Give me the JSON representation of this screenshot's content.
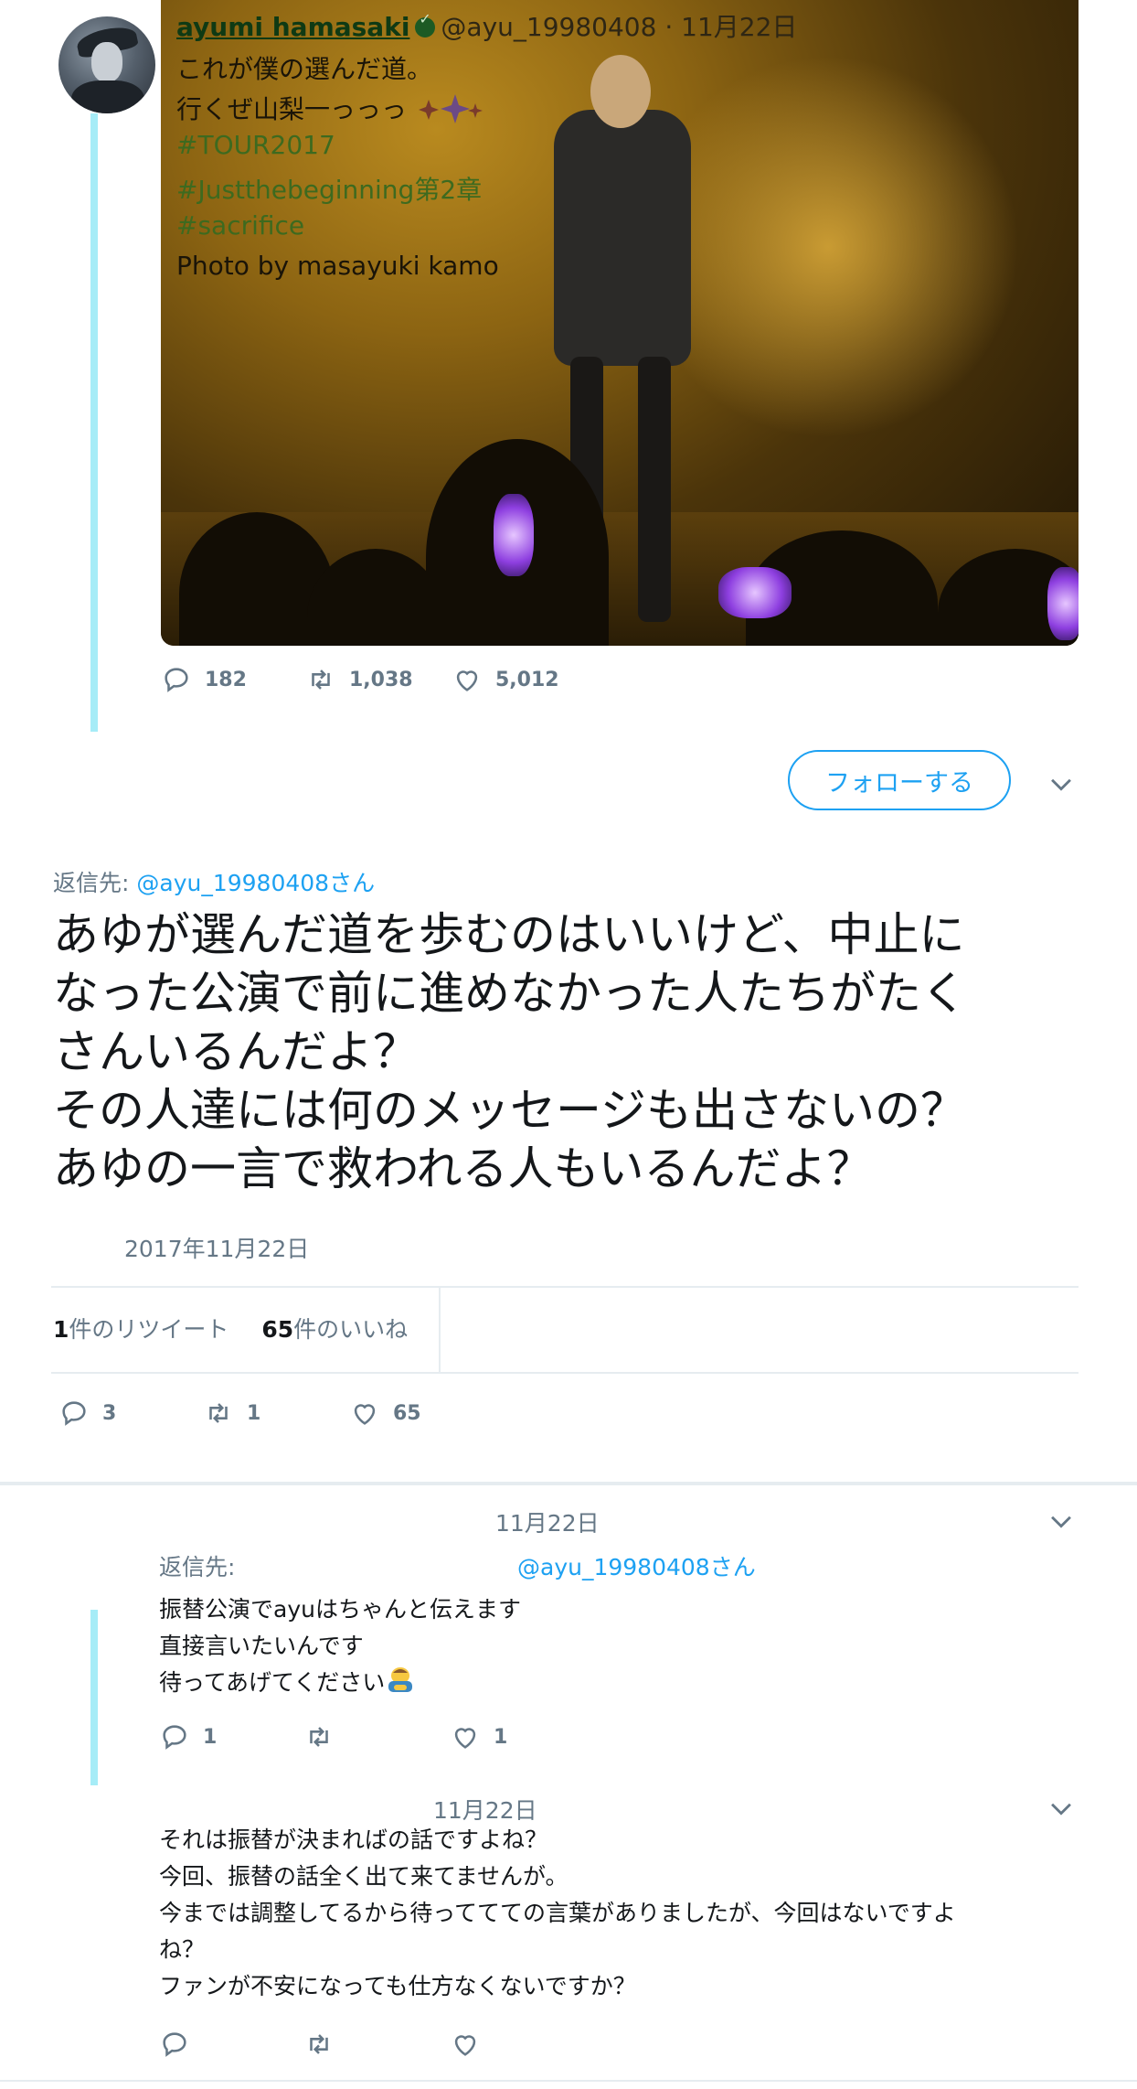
{
  "header_tweet": {
    "author_name": "ayumi hamasaki",
    "handle": "@ayu_19980408",
    "date": "· 11月22日",
    "lines": [
      "これが僕の選んだ道。",
      "行くぜ山梨一っっっ"
    ],
    "hashtags": [
      "#TOUR2017",
      "#Justthebeginning第2章",
      "#sacrifice"
    ],
    "photo_credit": "Photo by masayuki kamo",
    "replies": "182",
    "retweets": "1,038",
    "likes": "5,012"
  },
  "main_tweet": {
    "follow_label": "フォローする",
    "reply_to_prefix": "返信先: ",
    "reply_to_handle": "@ayu_19980408さん",
    "text_lines": [
      "あゆが選んだ道を歩むのはいいけど、中止に",
      "なった公演で前に進めなかった人たちがたく",
      "さんいるんだよ？",
      "その人達には何のメッセージも出さないの？",
      "あゆの一言で救われる人もいるんだよ？"
    ],
    "date": "2017年11月22日",
    "retweet_count": "1",
    "retweet_label": "件のリツイート",
    "like_count": "65",
    "like_label": "件のいいね",
    "replies": "3",
    "retweets": "1",
    "likes": "65"
  },
  "reply1": {
    "date": "11月22日",
    "reply_to_prefix": "返信先:",
    "reply_to_handle": "@ayu_19980408さん",
    "lines": [
      "振替公演でayuはちゃんと伝えます",
      "直接言いたいんです",
      "待ってあげてください"
    ],
    "replies": "1",
    "retweets": "",
    "likes": "1"
  },
  "reply2": {
    "date": "11月22日",
    "lines": [
      "それは振替が決まればの話ですよね？",
      "今回、振替の話全く出て来てませんが。",
      "今までは調整してるから待っててての言葉がありましたが、今回はないですよ",
      "ね？",
      "ファンが不安になっても仕方なくないですか？"
    ]
  },
  "colors": {
    "accent": "#1da1f2",
    "thread_line": "#a6ecf7",
    "muted": "#657786"
  },
  "icons": [
    "reply-icon",
    "retweet-icon",
    "like-icon",
    "chevron-down-icon",
    "verified-badge-icon",
    "sparkles-icon",
    "person-bowing-icon"
  ]
}
